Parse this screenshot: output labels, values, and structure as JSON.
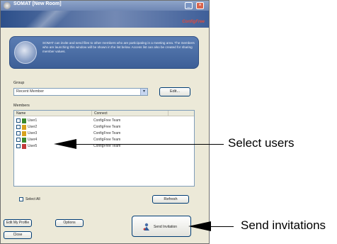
{
  "window": {
    "title": "SOMAT [New Room]",
    "min_glyph": "_",
    "close_glyph": "×",
    "brand": "ConfigFree"
  },
  "info": {
    "text": "SOMAT can invite and send files to other members who are participating in a meeting area. The members who are launching this window will be shown in the list below. Access list can also be created for sharing member values."
  },
  "group": {
    "label": "Group",
    "selected": "Recent Member",
    "edit_label": "Edit..."
  },
  "members": {
    "label": "Members",
    "columns": [
      "Name",
      "Connect"
    ],
    "rows": [
      {
        "name": "User1",
        "connect": "ConfigFree Team",
        "icon_color": "#3b8a2e"
      },
      {
        "name": "User2",
        "connect": "ConfigFree Team",
        "icon_color": "#d8a21e"
      },
      {
        "name": "User3",
        "connect": "ConfigFree Team",
        "icon_color": "#d8a21e"
      },
      {
        "name": "User4",
        "connect": "ConfigFree Team",
        "icon_color": "#3b8a2e"
      },
      {
        "name": "User5",
        "connect": "ConfigFree Team",
        "icon_color": "#c23b3b"
      }
    ]
  },
  "controls": {
    "select_all": "Select All",
    "refresh": "Refresh",
    "edit_profile": "Edit My Profile",
    "options": "Options",
    "close": "Close",
    "send": "Send Invitation"
  },
  "callouts": {
    "select_users": "Select users",
    "send_invitations": "Send invitations"
  }
}
